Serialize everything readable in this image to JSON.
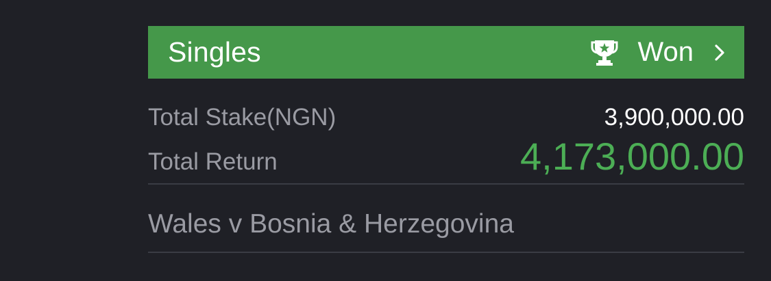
{
  "bet": {
    "type_label": "Singles",
    "status_label": "Won",
    "status_icon": "trophy-icon",
    "stake_label": "Total Stake(NGN)",
    "stake_value": "3,900,000.00",
    "return_label": "Total Return",
    "return_value": "4,173,000.00",
    "match": "Wales v Bosnia & Herzegovina"
  },
  "colors": {
    "background": "#1f2026",
    "header_green": "#45984a",
    "return_green": "#4cae55",
    "label_gray": "#9a9ba3",
    "divider": "#3a3c44"
  }
}
